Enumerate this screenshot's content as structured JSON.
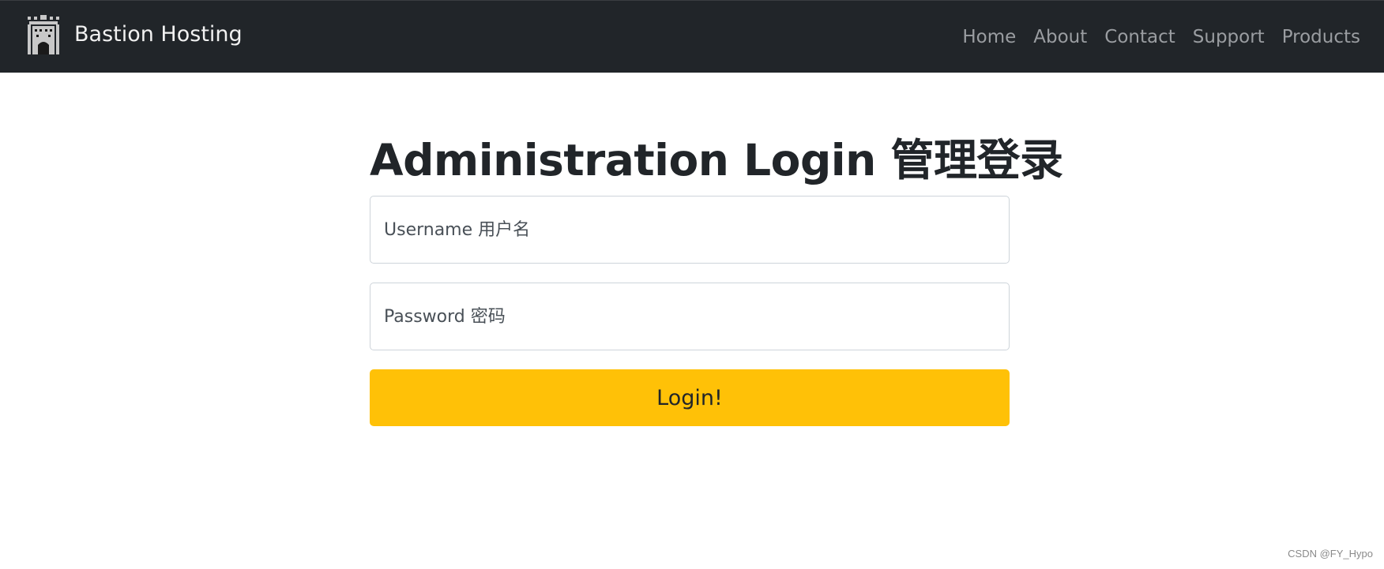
{
  "navbar": {
    "brand": {
      "icon": "castle-icon",
      "name": "Bastion Hosting"
    },
    "links": [
      {
        "label": "Home"
      },
      {
        "label": "About"
      },
      {
        "label": "Contact"
      },
      {
        "label": "Support"
      },
      {
        "label": "Products"
      }
    ]
  },
  "main": {
    "title": "Administration Login 管理登录",
    "username": {
      "value": "",
      "placeholder": "Username 用户名"
    },
    "password": {
      "value": "",
      "placeholder": "Password 密码"
    },
    "login_label": "Login!"
  },
  "watermark": "CSDN @FY_Hypo",
  "colors": {
    "navbar_background": "#212529",
    "brand_text": "#f1f1f1",
    "nav_link": "#9a9da1",
    "button_background": "#ffc107",
    "title_text": "#212529"
  }
}
